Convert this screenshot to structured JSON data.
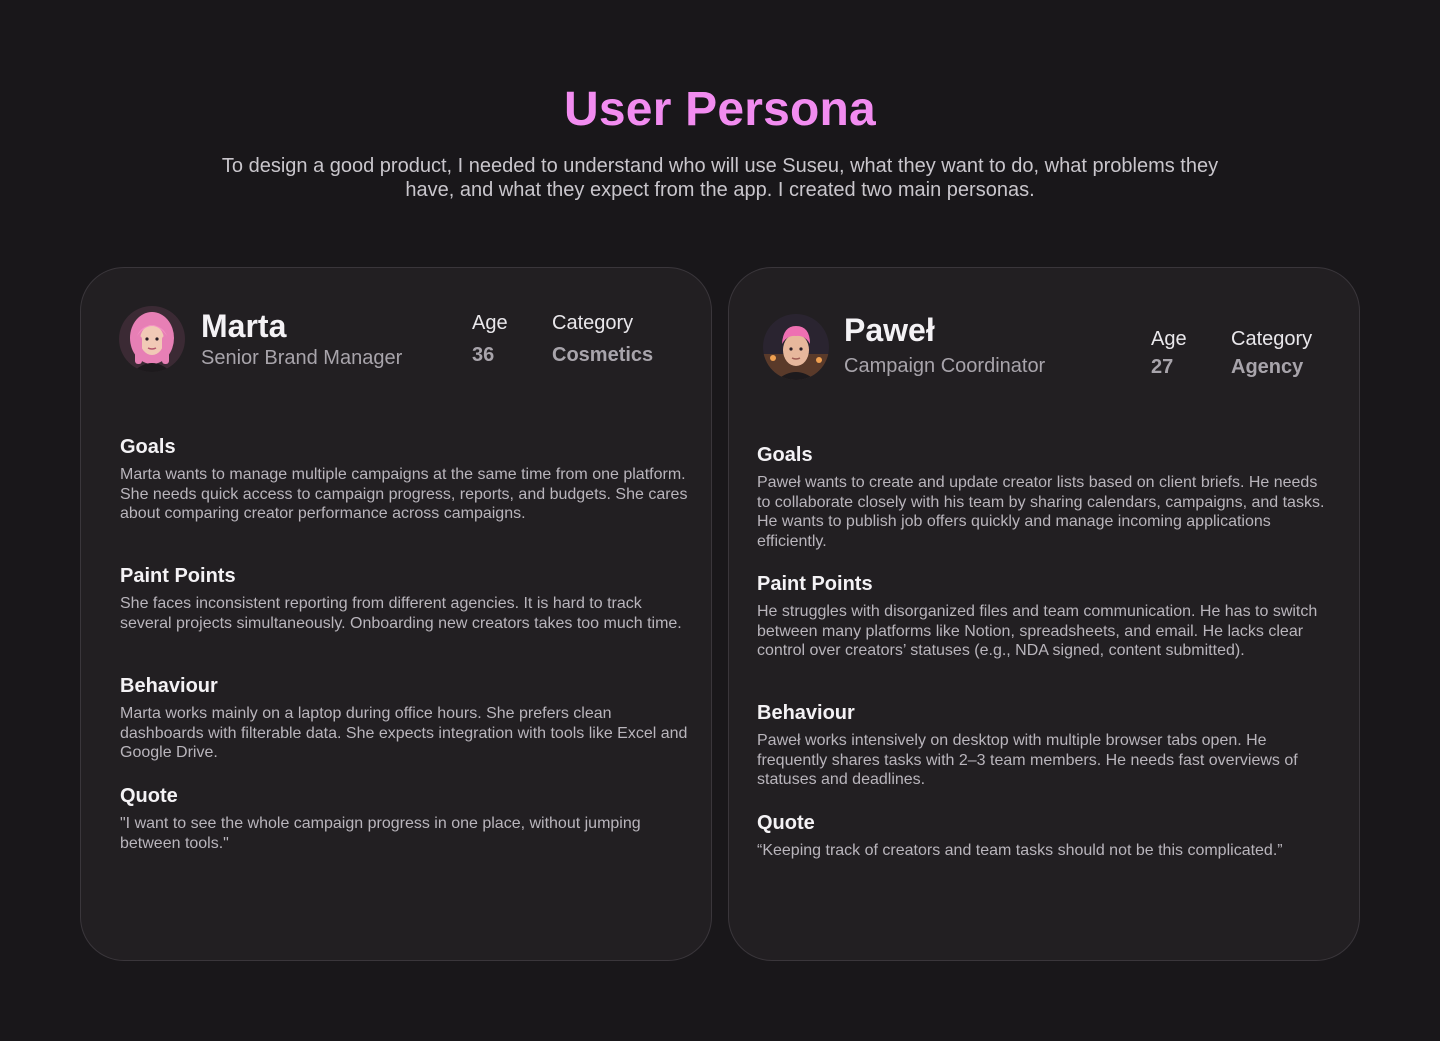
{
  "header": {
    "title": "User Persona",
    "subtitle": "To design a good product, I needed to understand who will use Suseu, what they want to do, what problems they have, and what they expect from the app. I created two main personas."
  },
  "personas": [
    {
      "name": "Marta",
      "role": "Senior Brand Manager",
      "age_label": "Age",
      "age": "36",
      "category_label": "Category",
      "category": "Cosmetics",
      "sections": [
        {
          "title": "Goals",
          "text": "Marta wants to manage multiple campaigns at the same time from one platform. She needs quick access to campaign progress, reports, and budgets. She cares about comparing creator performance across campaigns."
        },
        {
          "title": "Paint Points",
          "text": "She faces inconsistent reporting from different agencies. It is hard to track several projects simultaneously. Onboarding new creators takes too much time."
        },
        {
          "title": "Behaviour",
          "text": "Marta works mainly on a laptop during office hours. She prefers clean dashboards with filterable data. She expects integration with tools like Excel and Google Drive."
        },
        {
          "title": "Quote",
          "text": "\"I want to see the whole campaign progress in one place, without jumping between tools.\""
        }
      ]
    },
    {
      "name": "Paweł",
      "role": "Campaign Coordinator",
      "age_label": "Age",
      "age": "27",
      "category_label": "Category",
      "category": "Agency",
      "sections": [
        {
          "title": "Goals",
          "text": "Paweł wants to create and update creator lists based on client briefs. He needs to collaborate closely with his team by sharing calendars, campaigns, and tasks. He wants to publish job offers quickly and manage incoming applications efficiently."
        },
        {
          "title": "Paint Points",
          "text": "He struggles with disorganized files and team communication. He has to switch between many platforms like Notion, spreadsheets, and email. He lacks clear control over creators’ statuses (e.g., NDA signed, content submitted)."
        },
        {
          "title": "Behaviour",
          "text": "Paweł works intensively on desktop with multiple browser tabs open. He frequently shares tasks with 2–3 team members. He needs fast overviews of statuses and deadlines."
        },
        {
          "title": "Quote",
          "text": "“Keeping track of creators and team tasks should not be this complicated.”"
        }
      ]
    }
  ],
  "colors": {
    "background": "#19171a",
    "card": "#221f22",
    "accent": "#f28cf0",
    "muted": "#a8a4ab"
  }
}
